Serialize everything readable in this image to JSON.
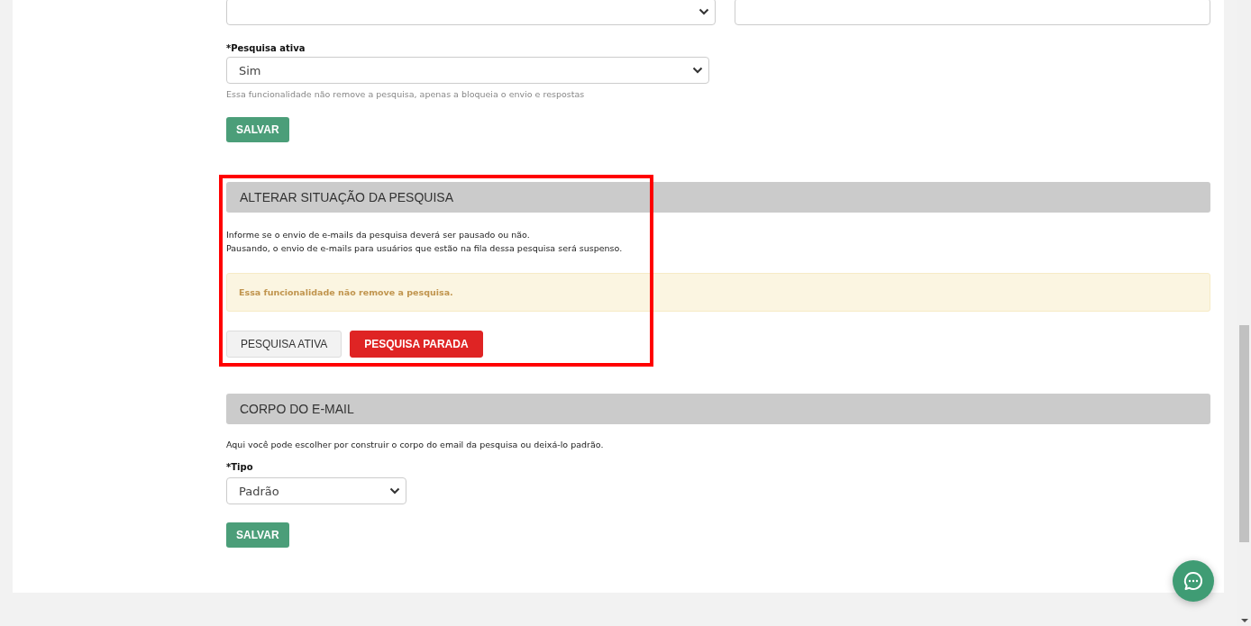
{
  "top_fields": [
    {
      "kind": "select"
    },
    {
      "kind": "input"
    }
  ],
  "active_field": {
    "label": "*Pesquisa ativa",
    "value": "Sim",
    "hint": "Essa funcionalidade não remove a pesquisa, apenas a bloqueia o envio e respostas"
  },
  "save_button_1": "SALVAR",
  "status_section": {
    "title": "ALTERAR SITUAÇÃO DA PESQUISA",
    "highlighted": true,
    "description": [
      "Informe se o envio de e-mails da pesquisa deverá ser pausado ou não.",
      "Pausando, o envio de e-mails para usuários que estão na fila dessa pesquisa será suspenso."
    ],
    "alert": "Essa funcionalidade não remove a pesquisa.",
    "buttons": [
      {
        "label": "PESQUISA ATIVA",
        "selected": false
      },
      {
        "label": "PESQUISA PARADA",
        "selected": true
      }
    ]
  },
  "email_section": {
    "title": "CORPO DO E-MAIL",
    "description": "Aqui você pode escolher por construir o corpo do email da pesquisa ou deixá-lo padrão.",
    "type_label": "*Tipo",
    "type_value": "Padrão",
    "save_button": "SALVAR"
  }
}
